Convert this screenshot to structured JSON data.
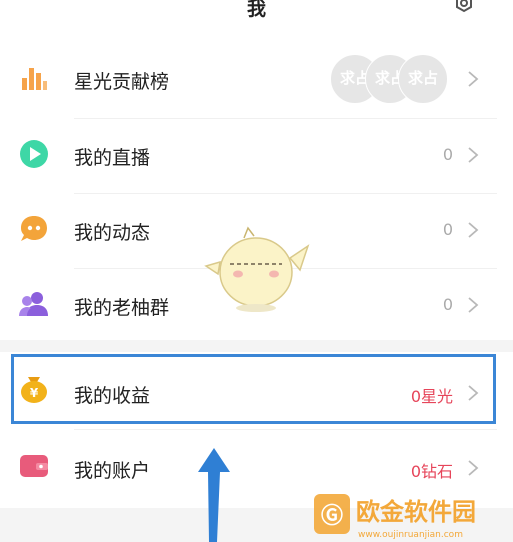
{
  "header": {
    "title": "我",
    "settings_icon": "gear-icon"
  },
  "rows": [
    {
      "label": "星光贡献榜",
      "value": "",
      "icon": "bar-chart-icon",
      "avatars": [
        "求占",
        "求占",
        "求占"
      ]
    },
    {
      "label": "我的直播",
      "value": "0",
      "icon": "play-icon"
    },
    {
      "label": "我的动态",
      "value": "0",
      "icon": "chat-dots-icon"
    },
    {
      "label": "我的老柚群",
      "value": "0",
      "icon": "group-icon"
    },
    {
      "label": "我的收益",
      "value": "0星光",
      "icon": "money-bag-icon",
      "highlighted": true
    },
    {
      "label": "我的账户",
      "value": "0钻石",
      "icon": "wallet-icon"
    }
  ],
  "colors": {
    "accent": "#e6455a",
    "highlight_border": "#3b86d6",
    "play_icon": "#3ed7a6",
    "chat_icon": "#f3a43a",
    "group_icon": "#8b5fdc",
    "money_icon": "#f2b21a",
    "wallet_icon": "#e85b7b",
    "bar_icon": "#f6a34a"
  },
  "watermark": {
    "text": "欧金软件园",
    "subtext": "www.oujinruanjian.com"
  }
}
